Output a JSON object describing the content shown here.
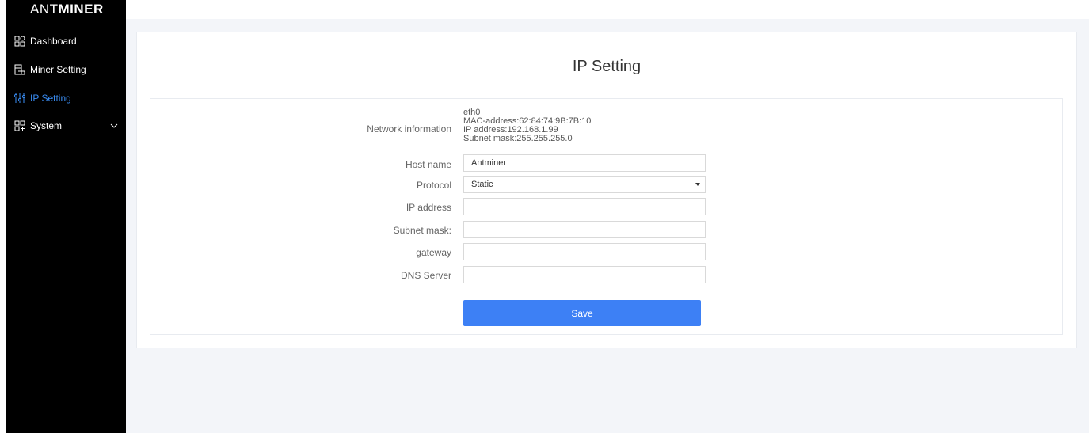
{
  "brand": {
    "logo_light": "ANT",
    "logo_bold": "MINER"
  },
  "sidebar": {
    "items": [
      {
        "label": "Dashboard",
        "icon": "dashboard-grid-icon"
      },
      {
        "label": "Miner Setting",
        "icon": "miner-setting-icon"
      },
      {
        "label": "IP Setting",
        "icon": "sliders-icon",
        "active": true
      },
      {
        "label": "System",
        "icon": "system-tree-icon",
        "has_submenu": true
      }
    ],
    "active_color": "#3a8ef6"
  },
  "page": {
    "title": "IP Setting"
  },
  "form": {
    "network_info": {
      "label": "Network information",
      "interface": "eth0",
      "mac": "MAC-address:62:84:74:9B:7B:10",
      "ip": "IP address:192.168.1.99",
      "mask": "Subnet mask:255.255.255.0"
    },
    "host_name": {
      "label": "Host name",
      "value": "Antminer"
    },
    "protocol": {
      "label": "Protocol",
      "value": "Static"
    },
    "ip_address": {
      "label": "IP address",
      "value": ""
    },
    "subnet_mask": {
      "label": "Subnet mask:",
      "value": ""
    },
    "gateway": {
      "label": "gateway",
      "value": ""
    },
    "dns_server": {
      "label": "DNS Server",
      "value": ""
    },
    "save_label": "Save"
  },
  "colors": {
    "sidebar_bg": "#000000",
    "primary_button": "#3d80f5",
    "page_bg": "#f3f5f9"
  }
}
